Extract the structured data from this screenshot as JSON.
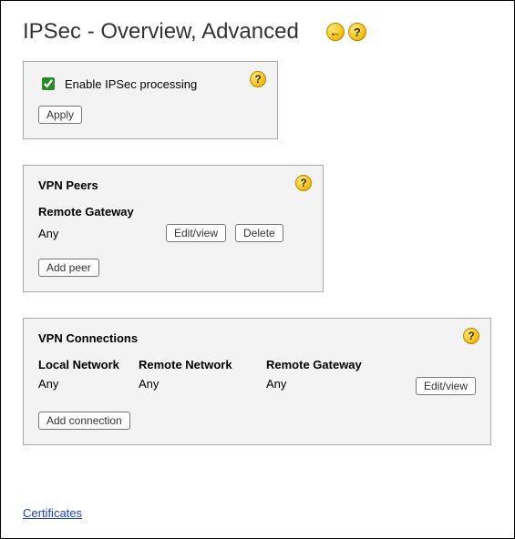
{
  "title": "IPSec - Overview, Advanced",
  "icons": {
    "back_arrow": "←",
    "help": "?"
  },
  "enable_panel": {
    "checkbox_label": "Enable IPSec processing",
    "checked": true,
    "apply_label": "Apply"
  },
  "vpn_peers": {
    "title": "VPN Peers",
    "column_header": "Remote Gateway",
    "rows": [
      {
        "gateway": "Any"
      }
    ],
    "edit_label": "Edit/view",
    "delete_label": "Delete",
    "add_label": "Add peer"
  },
  "vpn_connections": {
    "title": "VPN Connections",
    "columns": {
      "local": "Local Network",
      "remote_net": "Remote Network",
      "remote_gw": "Remote Gateway"
    },
    "rows": [
      {
        "local": "Any",
        "remote_net": "Any",
        "remote_gw": "Any"
      }
    ],
    "edit_label": "Edit/view",
    "add_label": "Add connection"
  },
  "certificates_link": "Certificates"
}
